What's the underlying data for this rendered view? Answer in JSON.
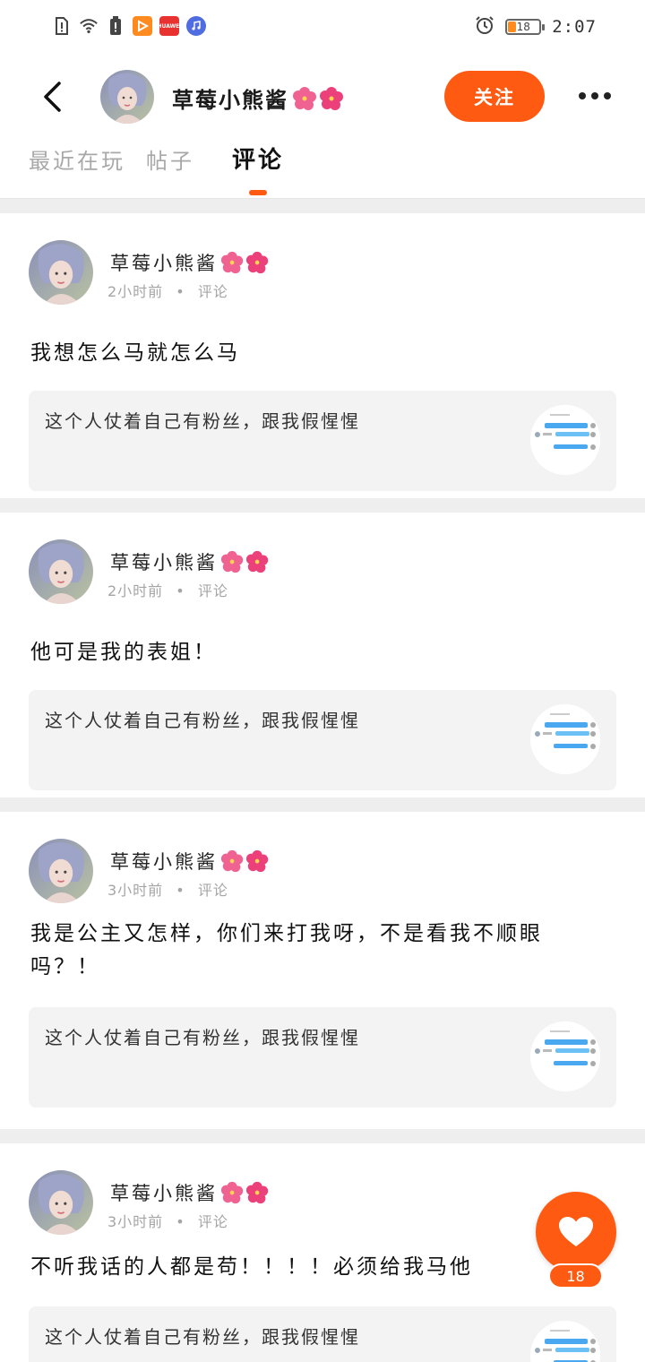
{
  "status_bar": {
    "time": "2:07",
    "battery_level": "18",
    "icons": [
      "sim-alert-icon",
      "wifi-icon",
      "battery-saver-icon",
      "video-app-icon",
      "huawei-video-icon",
      "music-app-icon",
      "alarm-icon"
    ],
    "huawei_label": "HUAWEI"
  },
  "header": {
    "username": "草莓小熊酱",
    "follow_label": "关注",
    "accent_color": "#ff5a12"
  },
  "tabs": [
    {
      "label": "最近在玩",
      "active": false
    },
    {
      "label": "帖子",
      "active": false
    },
    {
      "label": "评论",
      "active": true
    }
  ],
  "comments": [
    {
      "username": "草莓小熊酱",
      "time": "2小时前",
      "type": "评论",
      "text": "我想怎么马就怎么马",
      "quote": "这个人仗着自己有粉丝，跟我假惺惺"
    },
    {
      "username": "草莓小熊酱",
      "time": "2小时前",
      "type": "评论",
      "text": "他可是我的表姐！",
      "quote": "这个人仗着自己有粉丝，跟我假惺惺"
    },
    {
      "username": "草莓小熊酱",
      "time": "3小时前",
      "type": "评论",
      "text": "我是公主又怎样，你们来打我呀，不是看我不顺眼吗？！",
      "quote": "这个人仗着自己有粉丝，跟我假惺惺"
    },
    {
      "username": "草莓小熊酱",
      "time": "3小时前",
      "type": "评论",
      "text": "不听我话的人都是苟！！！！必须给我马他",
      "quote": "这个人仗着自己有粉丝，跟我假惺惺"
    }
  ],
  "like_button": {
    "count": "18"
  },
  "separator": "•"
}
